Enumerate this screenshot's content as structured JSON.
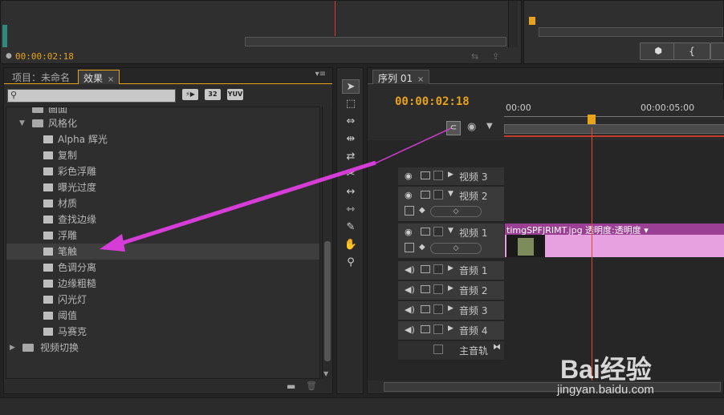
{
  "top_left": {
    "timecode": "00:00:02:18"
  },
  "effects_panel": {
    "tab_project": "项目：未命名",
    "tab_effects": "效果",
    "badge_32": "32",
    "badge_yuv": "YUV",
    "partial_folder": "画面",
    "folder_stylize": "风格化",
    "items": [
      "Alpha 辉光",
      "复制",
      "彩色浮雕",
      "曝光过度",
      "材质",
      "查找边缘",
      "浮雕",
      "笔触",
      "色调分离",
      "边缘粗糙",
      "闪光灯",
      "阈值",
      "马赛克"
    ],
    "selected_index": 7,
    "folder_video_transitions": "视频切换"
  },
  "sequence": {
    "tab": "序列 01",
    "timecode": "00:00:02:18",
    "ruler": [
      "00:00",
      "00:00:05:00"
    ],
    "tracks": [
      {
        "label": "视频 3"
      },
      {
        "label": "视频 2"
      },
      {
        "label": "视频 1"
      },
      {
        "label": "音频 1"
      },
      {
        "label": "音频 2"
      },
      {
        "label": "音频 3"
      },
      {
        "label": "音频 4"
      },
      {
        "label": "主音轨"
      }
    ],
    "clip_label": "timgSPFJRIMT.jpg  透明度:透明度 ▾"
  },
  "watermark": {
    "brand": "Bai经验",
    "url": "jingyan.baidu.com"
  },
  "colors": {
    "accent": "#e8a317",
    "arrow": "#d63cd6",
    "playhead": "#e24a2a",
    "clip": "#e7a1e0"
  }
}
